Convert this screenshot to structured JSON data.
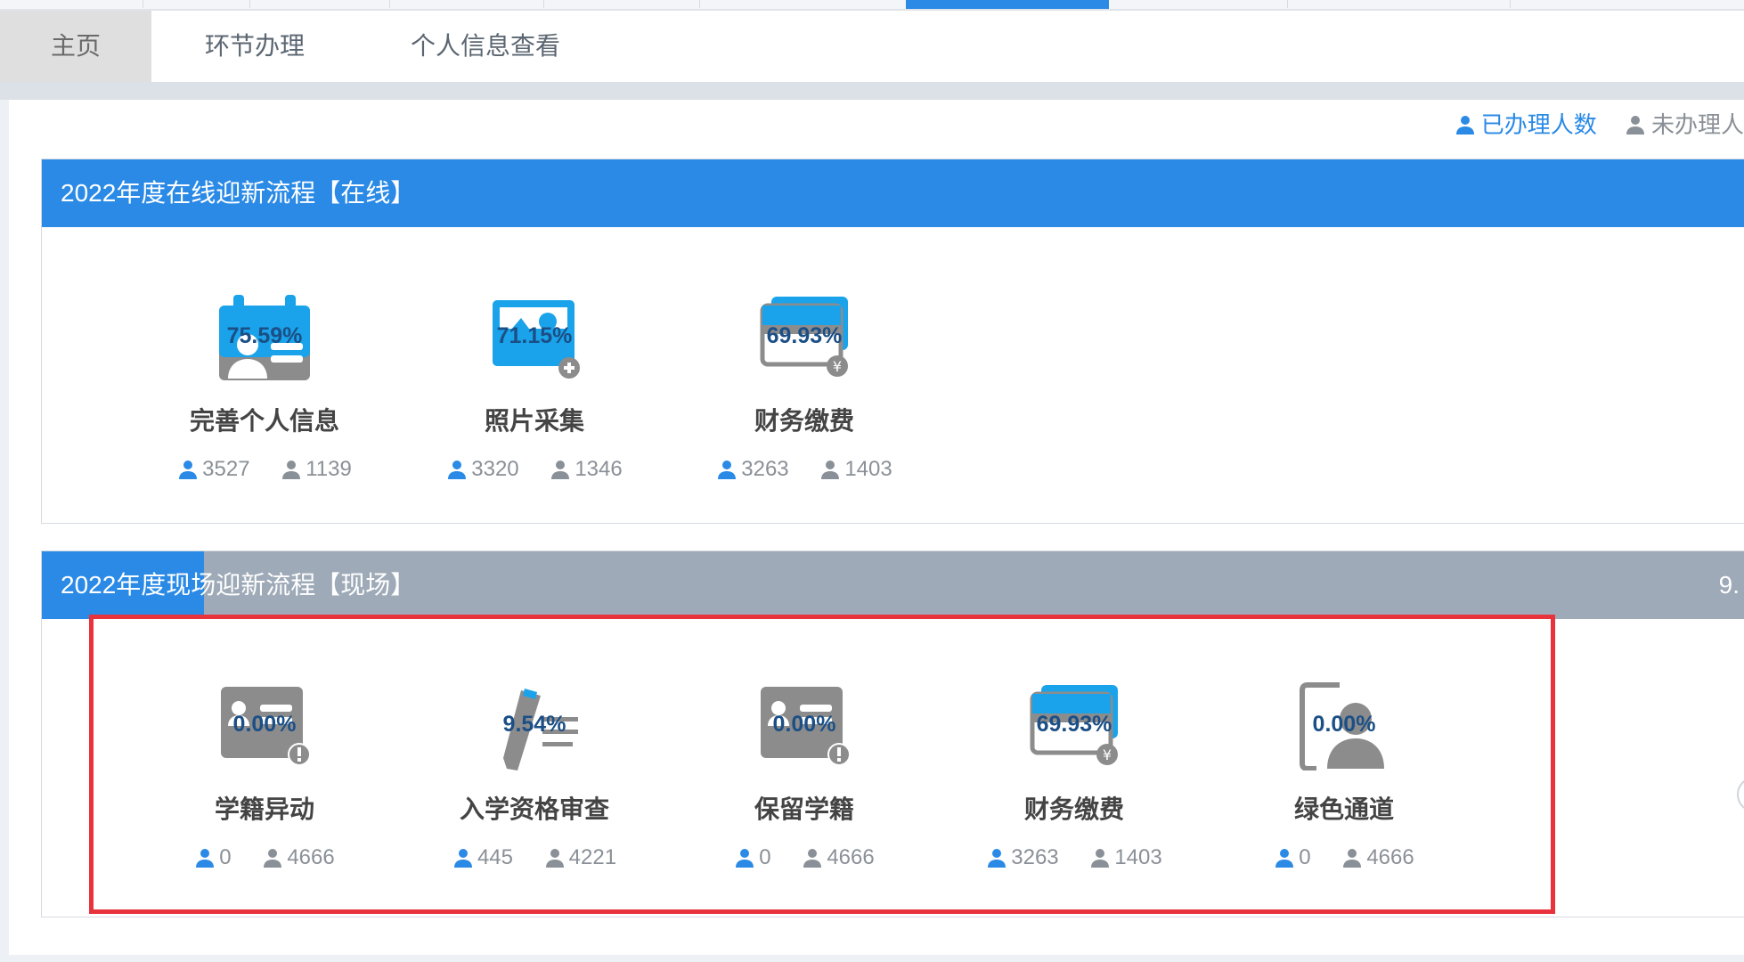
{
  "tabs": [
    {
      "label": "主页",
      "active": true
    },
    {
      "label": "环节办理",
      "active": false
    },
    {
      "label": "个人信息查看",
      "active": false
    }
  ],
  "legend": {
    "done_label": "已办理人数",
    "undone_label": "未办理人"
  },
  "colors": {
    "accent": "#2a8ae6",
    "header_gray": "#9eaab7",
    "highlight": "#e8323c"
  },
  "online": {
    "title": "2022年度在线迎新流程【在线】",
    "steps": [
      {
        "icon": "calendar-user-icon",
        "percent": "75.59%",
        "name": "完善个人信息",
        "done": "3527",
        "undone": "1139"
      },
      {
        "icon": "photo-icon",
        "percent": "71.15%",
        "name": "照片采集",
        "done": "3320",
        "undone": "1346"
      },
      {
        "icon": "payment-card-icon",
        "percent": "69.93%",
        "name": "财务缴费",
        "done": "3263",
        "undone": "1403"
      }
    ]
  },
  "onsite": {
    "title": "2022年度现场迎新流程【现场】",
    "percent_edge": "9.",
    "progress": 0.0954,
    "steps": [
      {
        "icon": "id-card-alert-icon",
        "percent": "0.00%",
        "name": "学籍异动",
        "done": "0",
        "undone": "4666"
      },
      {
        "icon": "pen-edit-icon",
        "percent": "9.54%",
        "name": "入学资格审查",
        "done": "445",
        "undone": "4221"
      },
      {
        "icon": "id-card-alert-icon",
        "percent": "0.00%",
        "name": "保留学籍",
        "done": "0",
        "undone": "4666"
      },
      {
        "icon": "payment-card-icon",
        "percent": "69.93%",
        "name": "财务缴费",
        "done": "3263",
        "undone": "1403"
      },
      {
        "icon": "green-channel-icon",
        "percent": "0.00%",
        "name": "绿色通道",
        "done": "0",
        "undone": "4666"
      }
    ]
  }
}
